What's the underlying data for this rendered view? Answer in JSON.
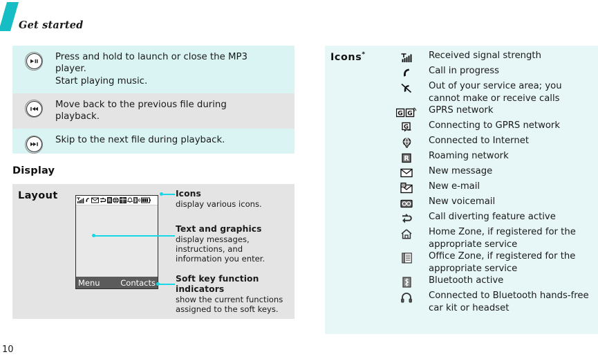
{
  "header": {
    "title": "Get started",
    "accent_color": "#16bdc4"
  },
  "page_number": "10",
  "key_table": {
    "rows": [
      {
        "icon": "play-pause-key-icon",
        "row_style": "tint",
        "lines": [
          "Press and hold to launch or close the MP3",
          "player.",
          "Start playing music."
        ]
      },
      {
        "icon": "previous-track-key-icon",
        "row_style": "gray",
        "lines": [
          "Move back to the previous file during",
          "playback."
        ]
      },
      {
        "icon": "next-track-key-icon",
        "row_style": "tint",
        "lines": [
          "Skip to the next file during playback."
        ]
      }
    ]
  },
  "display_section": {
    "heading": "Display",
    "layout_label": "Layout",
    "phone": {
      "status_icons": [
        "signal-strength-icon",
        "call-icon",
        "new-message-icon",
        "call-divert-icon",
        "roaming-icon",
        "internet-icon",
        "office-zone-icon",
        "alarm-icon",
        "bluetooth-icon",
        "battery-icon"
      ],
      "left_softkey": "Menu",
      "right_softkey": "Contacts"
    },
    "callouts": [
      {
        "title": "Icons",
        "body_lines": [
          "display various icons."
        ]
      },
      {
        "title": "Text and graphics",
        "body_lines": [
          "display messages,",
          "instructions, and",
          "information you enter."
        ]
      },
      {
        "title_lines": [
          "Soft key function",
          "indicators"
        ],
        "body_lines": [
          "show the current functions",
          "assigned to the soft keys."
        ]
      }
    ],
    "callout_color": "#16d7e4"
  },
  "icons_panel": {
    "title": "Icons",
    "title_superscript": "*",
    "background_color": "#e7f6f6",
    "rows": [
      {
        "icon": "signal-strength-icon",
        "lines": [
          "Received signal strength"
        ]
      },
      {
        "icon": "call-in-progress-icon",
        "lines": [
          "Call in progress"
        ]
      },
      {
        "icon": "no-service-icon",
        "lines": [
          "Out of your service area;  you",
          "cannot make or receive calls"
        ]
      },
      {
        "icon": "gprs-network-icon",
        "lines": [
          "GPRS network"
        ]
      },
      {
        "icon": "gprs-connecting-icon",
        "lines": [
          "Connecting to GPRS network"
        ]
      },
      {
        "icon": "internet-connected-icon",
        "lines": [
          "Connected to Internet"
        ]
      },
      {
        "icon": "roaming-network-icon",
        "lines": [
          "Roaming network"
        ]
      },
      {
        "icon": "new-message-icon",
        "lines": [
          "New message"
        ]
      },
      {
        "icon": "new-email-icon",
        "lines": [
          "New e-mail"
        ]
      },
      {
        "icon": "new-voicemail-icon",
        "lines": [
          "New voicemail"
        ]
      },
      {
        "icon": "call-diverting-icon",
        "lines": [
          "Call diverting feature active"
        ]
      },
      {
        "icon": "home-zone-icon",
        "lines": [
          "Home Zone, if registered for the",
          "appropriate service"
        ]
      },
      {
        "icon": "office-zone-icon",
        "lines": [
          "Office Zone, if registered for the",
          "appropriate service"
        ]
      },
      {
        "icon": "bluetooth-active-icon",
        "lines": [
          "Bluetooth active"
        ]
      },
      {
        "icon": "bluetooth-headset-icon",
        "lines": [
          "Connected to Bluetooth hands-free",
          "car kit or headset"
        ]
      }
    ]
  }
}
